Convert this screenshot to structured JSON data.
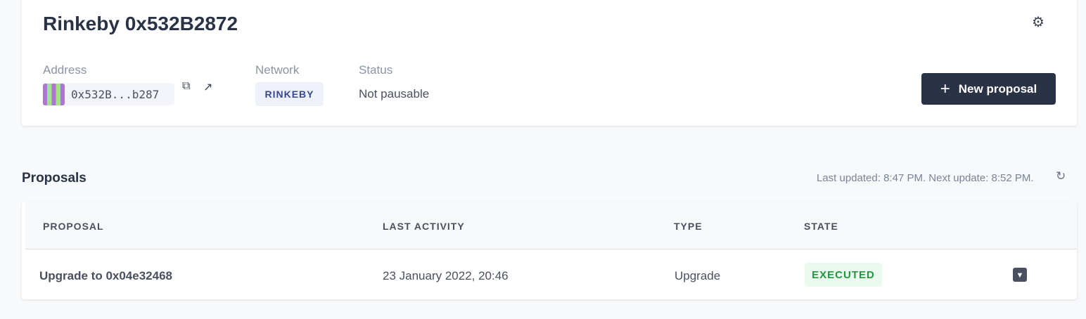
{
  "header": {
    "title": "Rinkeby 0x532B2872",
    "settings_icon": "gear-icon"
  },
  "info": {
    "address_label": "Address",
    "address": "0x532B...b287",
    "network_label": "Network",
    "network": "RINKEBY",
    "status_label": "Status",
    "status": "Not pausable"
  },
  "new_proposal": {
    "icon": "+",
    "label": "New proposal"
  },
  "proposals": {
    "title": "Proposals",
    "updated": "Last updated: 8:47 PM. Next update: 8:52 PM.",
    "columns": [
      "PROPOSAL",
      "LAST ACTIVITY",
      "TYPE",
      "STATE"
    ],
    "rows": [
      {
        "proposal": "Upgrade to 0x04e32468",
        "last_activity": "23 January 2022, 20:46",
        "type": "Upgrade",
        "state": "EXECUTED"
      }
    ]
  },
  "colors": {
    "accent": "#2a3346",
    "executed": "#22963e"
  }
}
